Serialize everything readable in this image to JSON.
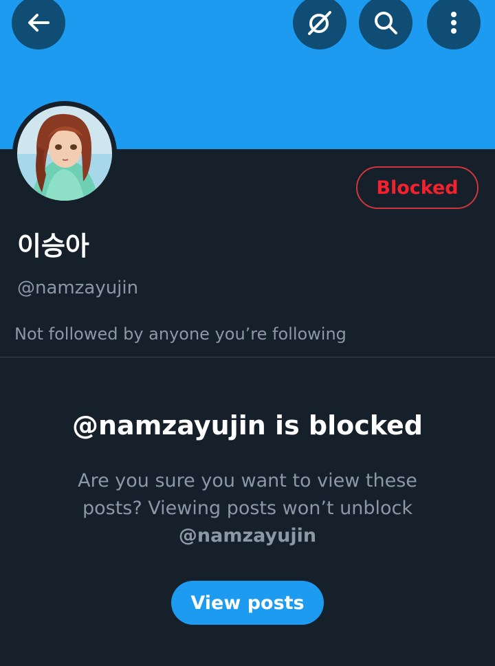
{
  "header": {
    "back_icon": "arrow-left-icon",
    "grok_icon": "grok-icon",
    "search_icon": "search-icon",
    "more_icon": "more-vertical-icon",
    "banner_color": "#1d9bf0"
  },
  "profile": {
    "display_name": "이승아",
    "handle": "@namzayujin",
    "follow_note": "Not followed by anyone you’re following",
    "blocked_label": "Blocked"
  },
  "blocked_notice": {
    "title": "@namzayujin is blocked",
    "description": "Are you sure you want to view these posts? Viewing posts won’t unblock",
    "handle": "@namzayujin",
    "view_posts_label": "View posts"
  },
  "colors": {
    "background": "#15202b",
    "accent": "#1d9bf0",
    "blocked_red": "#f4212e",
    "secondary_text": "#8b98a5"
  }
}
